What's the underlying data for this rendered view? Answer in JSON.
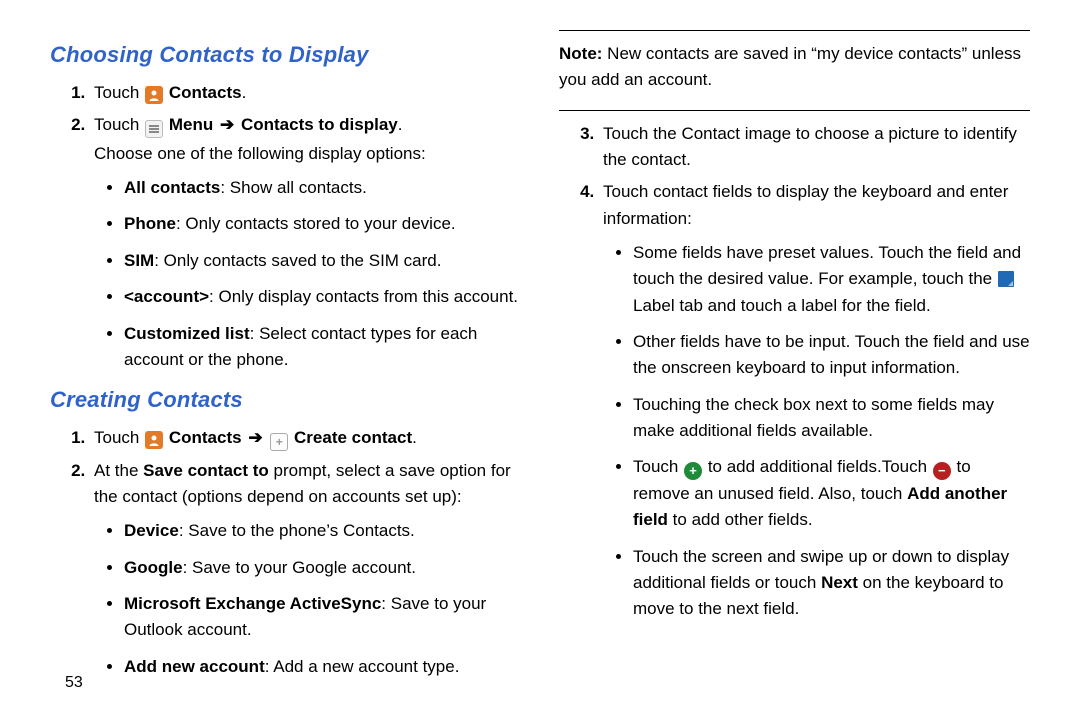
{
  "page": {
    "number": "53"
  },
  "left": {
    "heading1": "Choosing Contacts to Display",
    "step1_touch": "Touch",
    "contacts_label": "Contacts",
    "step2_touch": "Touch",
    "menu_label": "Menu",
    "contacts_to_display": "Contacts to display",
    "step2_tail": ".",
    "choose_intro": "Choose one of the following display options:",
    "opts": [
      {
        "b": "All contacts",
        "rest": ": Show all contacts."
      },
      {
        "b": "Phone",
        "rest": ": Only contacts stored to your device."
      },
      {
        "b": "SIM",
        "rest": ": Only contacts saved to the SIM card."
      },
      {
        "b": "<account>",
        "rest": ": Only display contacts from this account."
      },
      {
        "b": "Customized list",
        "rest": ": Select contact types for each account or the phone."
      }
    ],
    "heading2": "Creating Contacts",
    "c_step1_touch": "Touch",
    "c_contacts_label": "Contacts",
    "c_create_label": "Create contact",
    "c_step2_lead": "At the ",
    "c_step2_bold": "Save contact to",
    "c_step2_rest": " prompt, select a save option for the contact (options depend on accounts set up):",
    "c_opts": [
      {
        "b": "Device",
        "rest": ": Save to the phone’s Contacts."
      },
      {
        "b": "Google",
        "rest": ": Save to your Google account."
      },
      {
        "b": "Microsoft Exchange ActiveSync",
        "rest": ": Save to your Outlook account."
      },
      {
        "b": "Add new account",
        "rest": ": Add a new account type."
      }
    ]
  },
  "right": {
    "note_b": "Note:",
    "note_rest": " New contacts are saved in “my device contacts” unless you add an account.",
    "step3": "Touch the Contact image to choose a picture to identify the contact.",
    "step4": "Touch contact fields to display the keyboard and enter information:",
    "sub": {
      "a_lead": "Some fields have preset values. Touch the field and touch the desired value. For example, touch the ",
      "a_tail": " Label tab and touch a label for the field.",
      "b": "Other fields have to be input. Touch the field and use the onscreen keyboard to input information.",
      "c": "Touching the check box next to some fields may make additional fields available.",
      "d_touch1": "Touch ",
      "d_mid": " to add additional fields.Touch ",
      "d_mid2": " to remove an unused field. Also, touch ",
      "d_bold": "Add another field",
      "d_tail": " to add other fields.",
      "e_lead": "Touch the screen and swipe up or down to display additional fields or touch ",
      "e_bold": "Next",
      "e_tail": " on the keyboard to move to the next field."
    }
  }
}
